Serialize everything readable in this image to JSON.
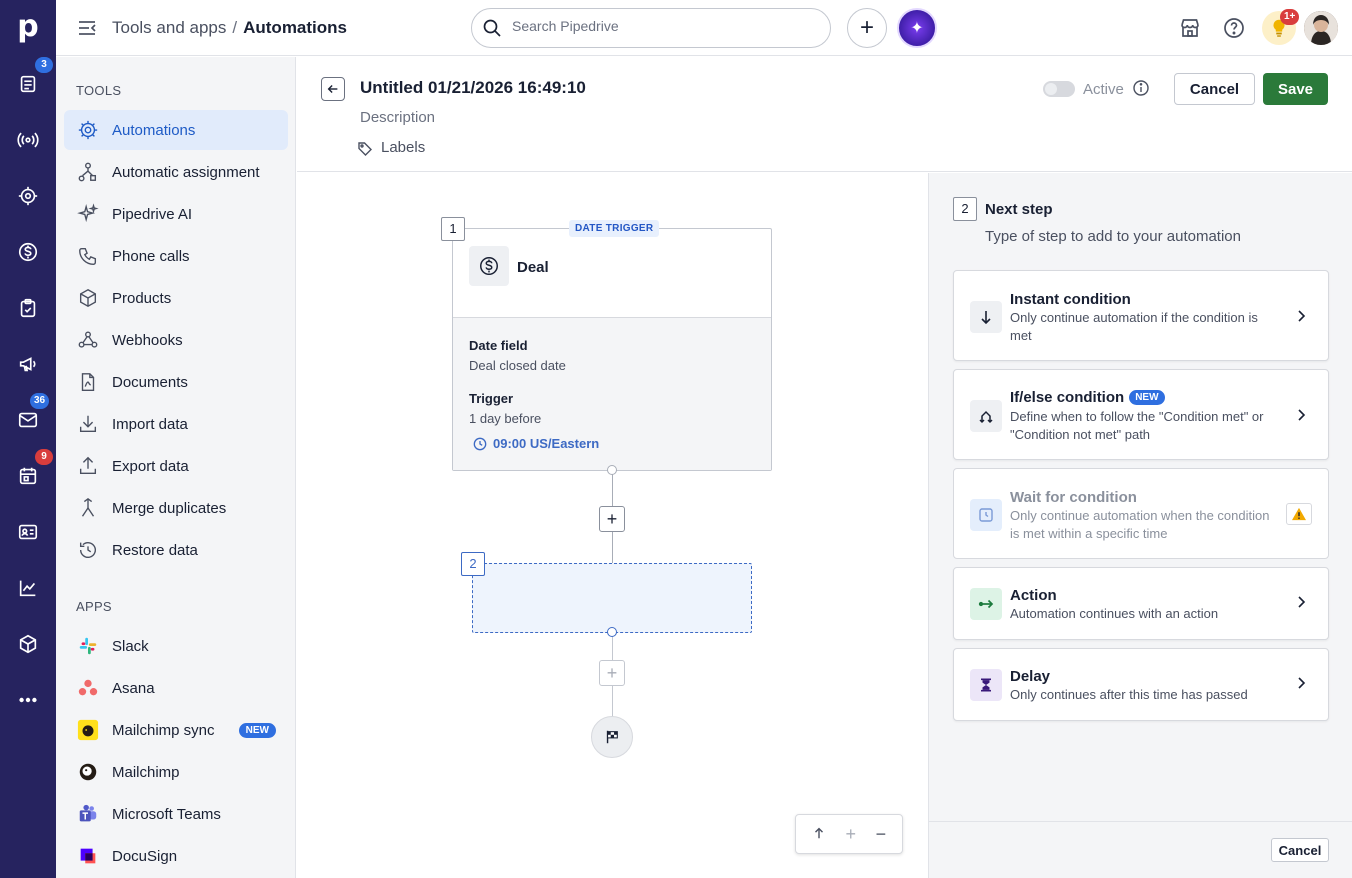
{
  "app": {
    "logo_letter": "p"
  },
  "rail": {
    "badges": {
      "leads": "3",
      "mail": "36",
      "activities": "9"
    }
  },
  "topbar": {
    "breadcrumb_parent": "Tools and apps",
    "breadcrumb_separator": "/",
    "breadcrumb_current": "Automations",
    "search_placeholder": "Search Pipedrive",
    "notifications_badge": "1+"
  },
  "sidebar": {
    "tools_heading": "TOOLS",
    "tools": [
      {
        "label": "Automations",
        "icon": "automations-icon",
        "active": true
      },
      {
        "label": "Automatic assignment",
        "icon": "assignment-icon"
      },
      {
        "label": "Pipedrive AI",
        "icon": "sparkle-icon"
      },
      {
        "label": "Phone calls",
        "icon": "phone-icon"
      },
      {
        "label": "Products",
        "icon": "box-icon"
      },
      {
        "label": "Webhooks",
        "icon": "webhook-icon"
      },
      {
        "label": "Documents",
        "icon": "document-icon"
      },
      {
        "label": "Import data",
        "icon": "import-icon"
      },
      {
        "label": "Export data",
        "icon": "export-icon"
      },
      {
        "label": "Merge duplicates",
        "icon": "merge-icon"
      },
      {
        "label": "Restore data",
        "icon": "restore-icon"
      }
    ],
    "apps_heading": "APPS",
    "apps": [
      {
        "label": "Slack",
        "icon": "slack-icon"
      },
      {
        "label": "Asana",
        "icon": "asana-icon"
      },
      {
        "label": "Mailchimp sync",
        "icon": "mailchimp-icon",
        "badge": "NEW"
      },
      {
        "label": "Mailchimp",
        "icon": "mailchimp-icon"
      },
      {
        "label": "Microsoft Teams",
        "icon": "teams-icon"
      },
      {
        "label": "DocuSign",
        "icon": "docusign-icon"
      }
    ]
  },
  "automation": {
    "title": "Untitled 01/21/2026 16:49:10",
    "description_placeholder": "Description",
    "labels_label": "Labels",
    "active_label": "Active",
    "active": false,
    "cancel_label": "Cancel",
    "save_label": "Save"
  },
  "canvas": {
    "step1_number": "1",
    "trigger_type_pill": "DATE TRIGGER",
    "trigger_entity": "Deal",
    "date_field_label": "Date field",
    "date_field_value": "Deal closed date",
    "trigger_label": "Trigger",
    "trigger_value": "1 day before",
    "trigger_time": "09:00 US/Eastern",
    "step2_number": "2"
  },
  "panel": {
    "step_number": "2",
    "title": "Next step",
    "subtitle": "Type of step to add to your automation",
    "options": [
      {
        "title": "Instant condition",
        "desc": "Only continue automation if the condition is met",
        "icon": "arrow-down-icon",
        "icon_bg": "#eef0f3"
      },
      {
        "title": "If/else condition",
        "badge": "NEW",
        "desc": "Define when to follow the \"Condition met\" or \"Condition not met\" path",
        "icon": "branch-icon",
        "icon_bg": "#eef0f3"
      },
      {
        "title": "Wait for condition",
        "desc": "Only continue automation when the condition is met within a specific time",
        "icon": "clock-icon",
        "icon_bg": "#e4eefc",
        "disabled": true
      },
      {
        "title": "Action",
        "desc": "Automation continues with an action",
        "icon": "action-arrow-icon",
        "icon_bg": "#ddf3e6"
      },
      {
        "title": "Delay",
        "desc": "Only continues after this time has passed",
        "icon": "hourglass-icon",
        "icon_bg": "#ece6f8"
      }
    ],
    "footer_cancel_label": "Cancel"
  },
  "colors": {
    "rail_bg": "#26235f",
    "accent_blue": "#1e5bc6",
    "save_green": "#2b7a3a",
    "badge_red": "#d93d3d"
  }
}
